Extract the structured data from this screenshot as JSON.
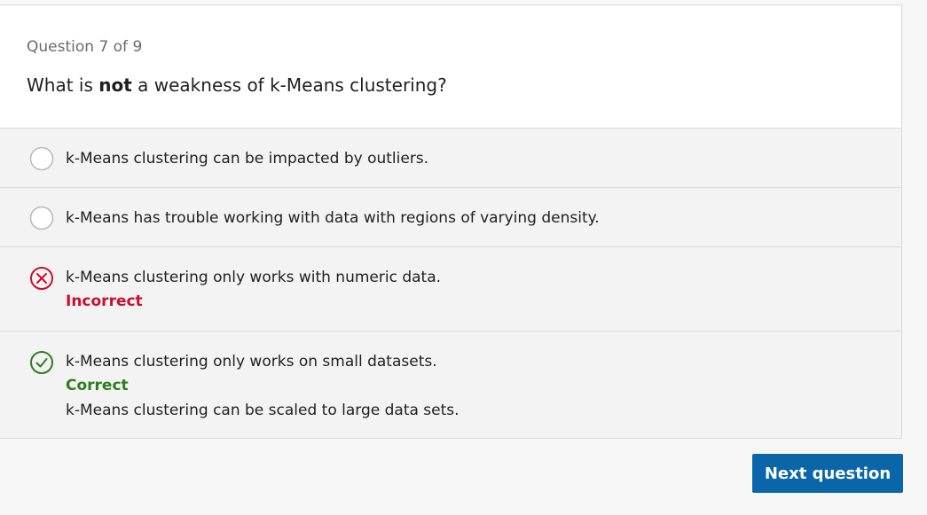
{
  "quiz": {
    "counter": "Question 7 of 9",
    "question_prefix": "What is ",
    "question_emphasis": "not",
    "question_suffix": " a weakness of k-Means clustering?",
    "options": [
      {
        "text": "k-Means clustering can be impacted by outliers.",
        "state": "unselected"
      },
      {
        "text": "k-Means has trouble working with data with regions of varying density.",
        "state": "unselected"
      },
      {
        "text": "k-Means clustering only works with numeric data.",
        "state": "incorrect",
        "status_label": "Incorrect"
      },
      {
        "text": "k-Means clustering only works on small datasets.",
        "state": "correct",
        "status_label": "Correct",
        "feedback": "k-Means clustering can be scaled to large data sets."
      }
    ]
  },
  "footer": {
    "next_label": "Next question"
  },
  "colors": {
    "incorrect": "#c8102e",
    "correct": "#2e7d1f",
    "button": "#0a66a8"
  },
  "icons": {
    "unselected": "radio-empty-icon",
    "incorrect": "x-circle-icon",
    "correct": "check-circle-icon"
  }
}
